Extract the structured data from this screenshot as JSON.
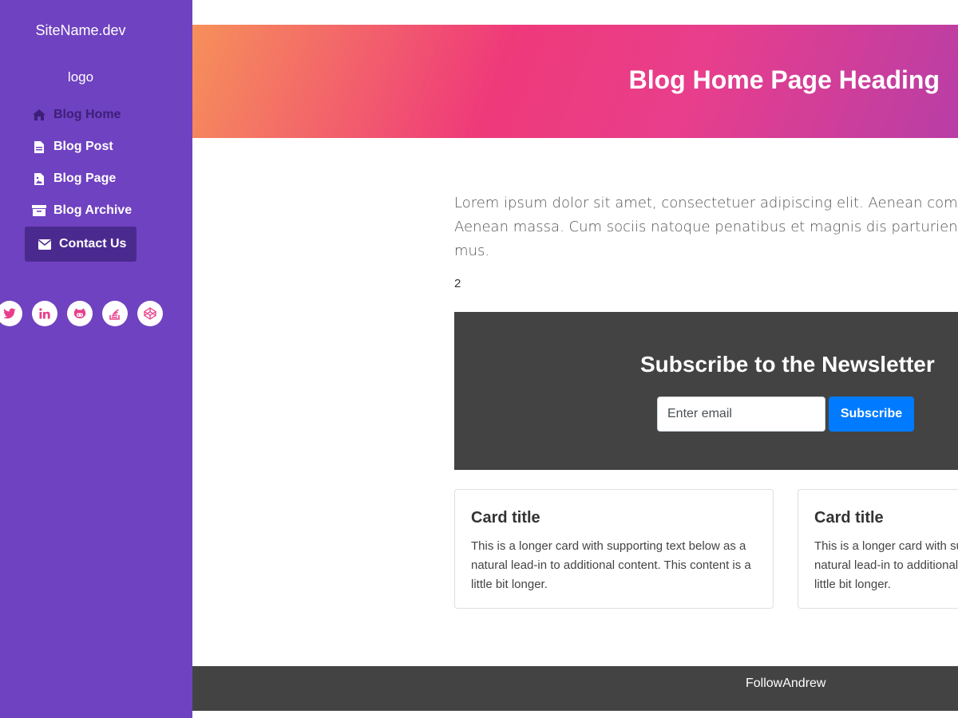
{
  "sidebar": {
    "site_name": "SiteName.dev",
    "logo": "logo",
    "nav": [
      {
        "label": "Blog Home",
        "icon": "home-icon"
      },
      {
        "label": "Blog Post",
        "icon": "file-icon"
      },
      {
        "label": "Blog Page",
        "icon": "file-image-icon"
      },
      {
        "label": "Blog Archive",
        "icon": "archive-icon"
      },
      {
        "label": "Contact Us",
        "icon": "envelope-icon"
      }
    ],
    "social": [
      "twitter-icon",
      "linkedin-icon",
      "github-icon",
      "stackoverflow-icon",
      "codepen-icon"
    ]
  },
  "hero": {
    "title": "Blog Home Page Heading"
  },
  "content": {
    "lorem_line1": "Lorem ipsum dolor sit amet, consectetuer adipiscing elit. Aenean commodo",
    "lorem_line2": "Aenean massa. Cum sociis natoque penatibus et magnis dis parturient mont",
    "lorem_line3": "mus.",
    "number": "2"
  },
  "newsletter": {
    "title": "Subscribe to the Newsletter",
    "placeholder": "Enter email",
    "button": "Subscribe"
  },
  "cards": [
    {
      "title": "Card title",
      "text": "This is a longer card with supporting text below as a natural lead-in to additional content. This content is a little bit longer."
    },
    {
      "title": "Card title",
      "text": "This is a longer card with supporting text below as a natural lead-in to additional content. This content is a little bit longer."
    }
  ],
  "footer": {
    "text": "FollowAndrew"
  },
  "colors": {
    "sidebar": "#6f42c1",
    "accent": "#e83e8c",
    "button": "#007bff",
    "dark": "#434343"
  }
}
